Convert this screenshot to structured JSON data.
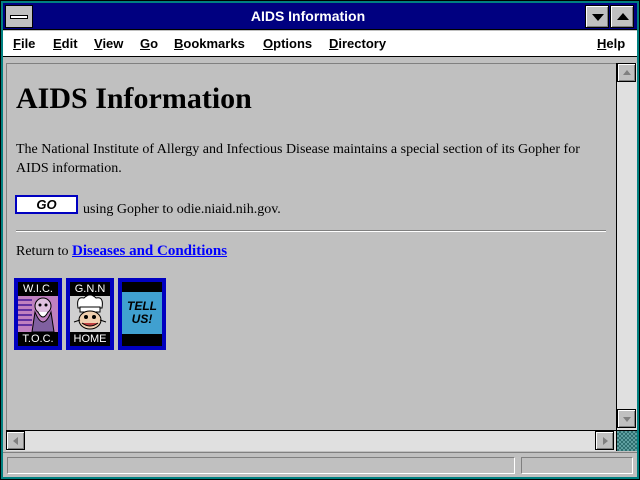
{
  "window": {
    "title": "AIDS Information"
  },
  "menu": [
    {
      "label": "File"
    },
    {
      "label": "Edit"
    },
    {
      "label": "View"
    },
    {
      "label": "Go"
    },
    {
      "label": "Bookmarks"
    },
    {
      "label": "Options"
    },
    {
      "label": "Directory"
    },
    {
      "label": "Help"
    }
  ],
  "page": {
    "heading": "AIDS Information",
    "intro": "The National Institute of Allergy and Infectious Disease maintains a special section of its Gopher for AIDS information.",
    "go_button": "GO",
    "go_text": "using Gopher to odie.niaid.nih.gov.",
    "return_prefix": "Return to",
    "return_link": "Diseases and Conditions",
    "icons": [
      {
        "top": "W.I.C.",
        "bottom": "T.O.C."
      },
      {
        "top": "G.N.N",
        "bottom": "HOME"
      },
      {
        "text": "TELL US!"
      }
    ]
  },
  "colors": {
    "title_bar": "#000080",
    "frame": "#008080",
    "link": "#0000ff",
    "background": "#c0c0c0"
  }
}
